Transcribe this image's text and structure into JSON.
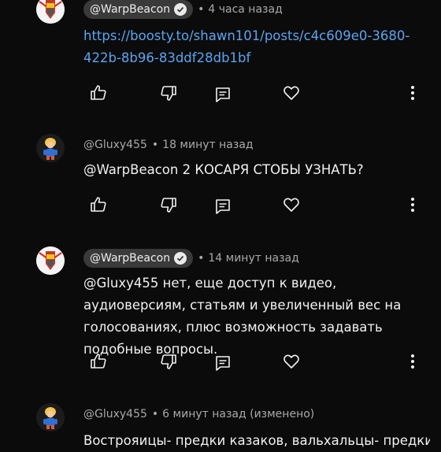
{
  "comments": [
    {
      "author": "@WarpBeacon",
      "verified": true,
      "time": "4 часа назад",
      "text": "https://boosty.to/shawn101/posts/c4c609e0-3680-422b-8b96-83ddf28db1bf",
      "is_link": true
    },
    {
      "author": "@Gluxy455",
      "verified": false,
      "time": "18 минут назад",
      "text": "@WarpBeacon  2 КОСАРЯ СТОБЫ УЗНАТЬ?"
    },
    {
      "author": "@WarpBeacon",
      "verified": true,
      "time": "14 минут назад",
      "text": "@Gluxy455  нет, еще доступ к видео, аудиоверсиям, статьям и увеличенный вес на голосованиях, плюс возможность задавать подобные вопросы."
    },
    {
      "author": "@Gluxy455",
      "verified": false,
      "time": "6 минут назад (изменено)",
      "text": "Вострояицы- предки казаков, вальхальцы- предки"
    }
  ],
  "icons": {
    "like": "thumbs-up-icon",
    "dislike": "thumbs-down-icon",
    "reply": "reply-icon",
    "heart": "heart-icon",
    "more": "more-vert-icon",
    "verified": "verified-check-icon"
  },
  "colors": {
    "background": "#0b0b0b",
    "link": "#5aa5f0",
    "chip": "#3a3a3a",
    "meta": "#a9a9a9"
  }
}
